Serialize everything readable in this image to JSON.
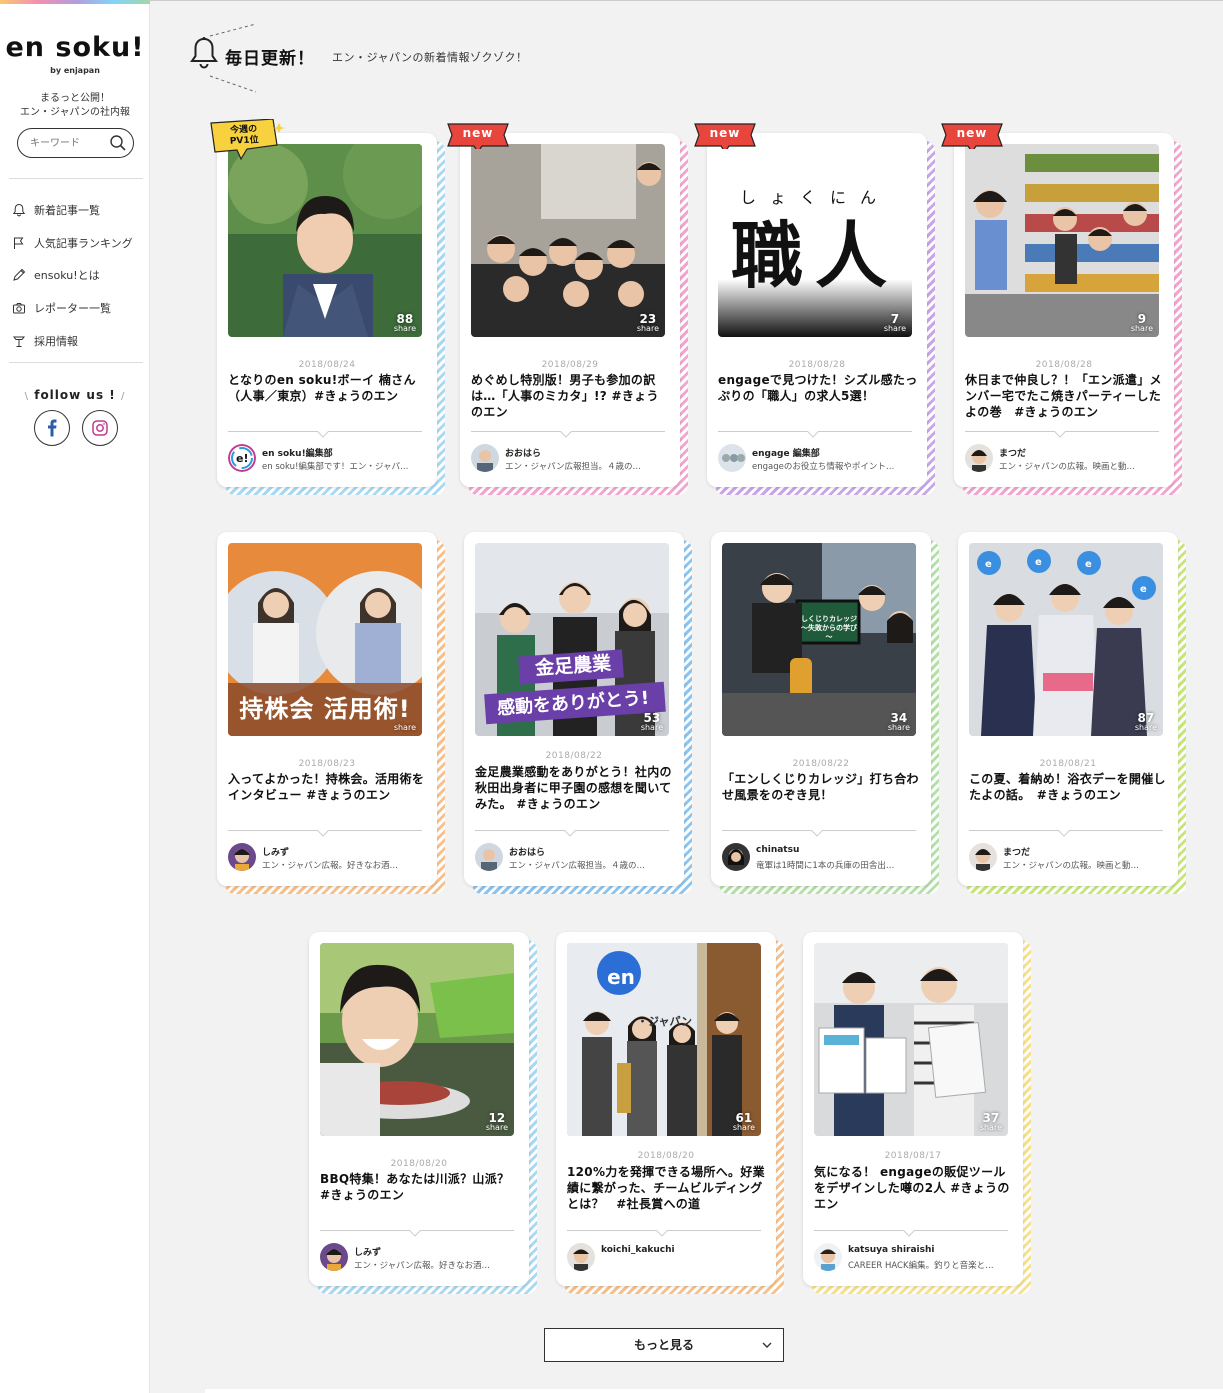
{
  "brand": {
    "logo": "en soku!",
    "logo_sub": "by enjapan",
    "tagline_1": "まるっと公開！",
    "tagline_2": "エン・ジャパンの社内報"
  },
  "search": {
    "placeholder": "キーワード"
  },
  "nav": [
    {
      "label": "新着記事一覧",
      "icon": "bell-icon"
    },
    {
      "label": "人気記事ランキング",
      "icon": "flag-icon"
    },
    {
      "label": "ensoku!とは",
      "icon": "pencil-icon"
    },
    {
      "label": "レポーター一覧",
      "icon": "camera-icon"
    },
    {
      "label": "採用情報",
      "icon": "lamp-icon"
    }
  ],
  "follow": {
    "label": "follow us !",
    "slash_left": "\\",
    "slash_right": "/"
  },
  "section": {
    "title": "毎日更新！",
    "subtitle": "エン・ジャパンの新着情報ゾクゾク！"
  },
  "colors": {
    "new_ribbon": "#e8453c",
    "pv_ribbon": "#f7d23e",
    "accent_blue": "#2b5ea7"
  },
  "cards": [
    {
      "badge": "pv",
      "badge_text_1": "今週の",
      "badge_text_2": "PV1位",
      "share": "88",
      "share_label": "share",
      "date": "2018/08/24",
      "title": "となりのen soku!ボーイ 楠さん（人事／東京）#きょうのエン",
      "author": "en soku!編集部",
      "desc": "en soku!編集部です！エン・ジャパ…",
      "stripe": "#a8d8f2"
    },
    {
      "badge": "new",
      "badge_text": "new",
      "share": "23",
      "share_label": "share",
      "date": "2018/08/29",
      "title": "めぐめし特別版！男子も参加の訳は…「人事のミカタ」!? #きょうのエン",
      "author": "おおはら",
      "desc": "エン・ジャパン広報担当。４歳の…",
      "stripe": "#f2a5cf"
    },
    {
      "badge": "new",
      "badge_text": "new",
      "share": "7",
      "share_label": "share",
      "date": "2018/08/28",
      "title": "engageで見つけた！シズル感たっぷりの「職人」の求人5選！",
      "author": "engage 編集部",
      "desc": "engageのお役立ち情報やポイント…",
      "stripe": "#c9a6e6",
      "thumb_kana": "しょくにん",
      "thumb_kanji": "職人"
    },
    {
      "badge": "new",
      "badge_text": "new",
      "share": "9",
      "share_label": "share",
      "date": "2018/08/28",
      "title": "休日まで仲良し？！「エン派遣」メンバー宅でたこ焼きパーティーしたよの巻　#きょうのエン",
      "author": "まつだ",
      "desc": "エン・ジャパンの広報。映画と動…",
      "stripe": "#f2a5cf"
    },
    {
      "badge": "",
      "share": "",
      "share_label": "share",
      "date": "2018/08/23",
      "title": "入ってよかった！持株会。活用術をインタビュー #きょうのエン",
      "author": "しみず",
      "desc": "エン・ジャパン広報。好きなお酒…",
      "stripe": "#f7c08a",
      "thumb_text": "持株会 活用術!"
    },
    {
      "badge": "",
      "share": "53",
      "share_label": "share",
      "date": "2018/08/22",
      "title": "金足農業感動をありがとう！社内の秋田出身者に甲子園の感想を聞いてみた。 #きょうのエン",
      "author": "おおはら",
      "desc": "エン・ジャパン広報担当。４歳の…",
      "stripe": "#8cc4f0",
      "thumb_text_1": "金足農業",
      "thumb_text_2": "感動をありがとう!"
    },
    {
      "badge": "",
      "share": "34",
      "share_label": "share",
      "date": "2018/08/22",
      "title": "「エンしくじりカレッジ」打ち合わせ風景をのぞき見！",
      "author": "chinatsu",
      "desc": "竜軍は1時間に1本の兵庫の田舎出…",
      "stripe": "#b3e0a6",
      "thumb_screen_1": "しくじりカレッジ",
      "thumb_screen_2": "～失敗からの学び～"
    },
    {
      "badge": "",
      "share": "87",
      "share_label": "share",
      "date": "2018/08/21",
      "title": "この夏、着納め！浴衣デーを開催したよの話。　#きょうのエン",
      "author": "まつだ",
      "desc": "エン・ジャパンの広報。映画と動…",
      "stripe": "#c7e67a"
    },
    {
      "badge": "",
      "share": "12",
      "share_label": "share",
      "date": "2018/08/20",
      "title": "BBQ特集！あなたは川派？山派？ #きょうのエン",
      "author": "しみず",
      "desc": "エン・ジャパン広報。好きなお酒…",
      "stripe": "#a8d8f2"
    },
    {
      "badge": "",
      "share": "61",
      "share_label": "share",
      "date": "2018/08/20",
      "title": "120%力を発揮できる場所へ。好業績に繋がった、チームビルディングとは？　#社長賞への道",
      "author": "koichi_kakuchi",
      "desc": "",
      "stripe": "#f7c08a",
      "thumb_logo": "en",
      "thumb_sign": "・ジャパン"
    },
    {
      "badge": "",
      "share": "37",
      "share_label": "share",
      "date": "2018/08/17",
      "title": "気になる！ engageの販促ツールをデザインした噂の2人 #きょうのエン",
      "author": "katsuya shiraishi",
      "desc": "CAREER HACK編集。釣りと音楽と…",
      "stripe": "#f7e08a"
    }
  ],
  "more": {
    "label": "もっと見る"
  }
}
